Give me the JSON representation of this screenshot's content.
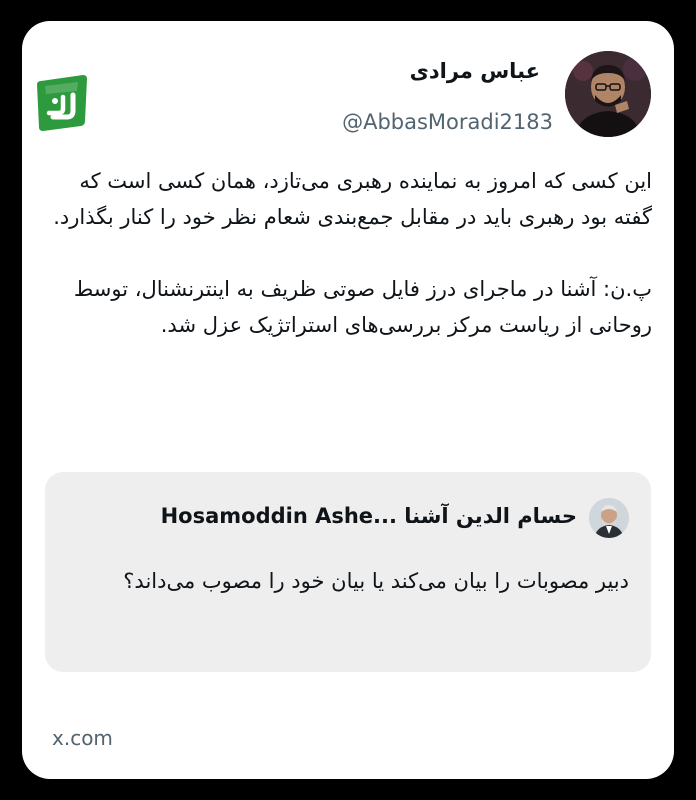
{
  "author": {
    "display_name": "عباس مرادی",
    "handle": "@AbbasMoradi2183"
  },
  "tweet": {
    "paragraphs": [
      "این کسی که امروز به نماینده رهبری می‌تازد، همان کسی است که گفته بود رهبری باید در مقابل جمع‌بندی شعام نظر خود را کنار بگذارد.",
      "پ.ن: آشنا در ماجرای درز فایل صوتی ظریف به اینترنشنال، توسط روحانی از ریاست مرکز بررسی‌های استراتژیک عزل شد."
    ]
  },
  "quoted_tweet": {
    "author_name": "حسام الدین آشنا ...Hosamoddin Ashe",
    "text": "دبیر مصوبات را بیان می‌کند یا بیان خود را مصوب می‌داند؟"
  },
  "footer": {
    "source": "x.com"
  },
  "logo": {
    "text": "رجا",
    "color": "#2e9a3e"
  },
  "icons": {
    "avatar": "profile-photo",
    "quote_avatar": "profile-photo"
  }
}
